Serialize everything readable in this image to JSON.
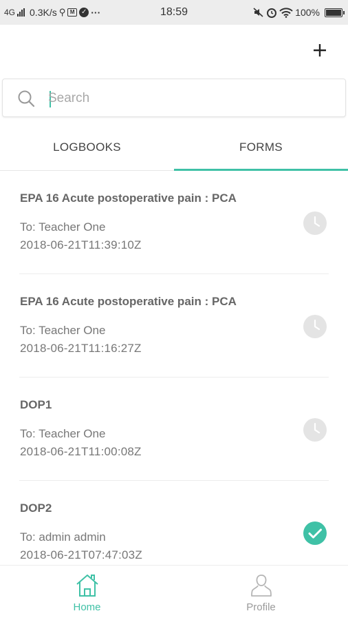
{
  "status_bar": {
    "network": "4G",
    "speed": "0.3K/s",
    "time": "18:59",
    "battery": "100%",
    "dots": "···"
  },
  "search": {
    "placeholder": "Search"
  },
  "tabs": [
    {
      "label": "LOGBOOKS",
      "active": false
    },
    {
      "label": "FORMS",
      "active": true
    }
  ],
  "forms": [
    {
      "title": "EPA 16 Acute postoperative pain : PCA",
      "to": "To: Teacher One",
      "date": "2018-06-21T11:39:10Z",
      "status": "pending",
      "status_icon": "clock-icon"
    },
    {
      "title": "EPA 16 Acute postoperative pain : PCA",
      "to": "To: Teacher One",
      "date": "2018-06-21T11:16:27Z",
      "status": "pending",
      "status_icon": "clock-icon"
    },
    {
      "title": "DOP1",
      "to": "To: Teacher One",
      "date": "2018-06-21T11:00:08Z",
      "status": "pending",
      "status_icon": "clock-icon"
    },
    {
      "title": "DOP2",
      "to": "To: admin admin",
      "date": "2018-06-21T07:47:03Z",
      "status": "completed",
      "status_icon": "check-circle-icon"
    }
  ],
  "bottom_nav": {
    "home": {
      "label": "Home",
      "icon": "home-icon",
      "active": true
    },
    "profile": {
      "label": "Profile",
      "icon": "profile-icon",
      "active": false
    }
  },
  "colors": {
    "accent": "#3fc1a6",
    "pending_icon": "#e4e4e4",
    "status_bar_bg": "#ededed"
  }
}
